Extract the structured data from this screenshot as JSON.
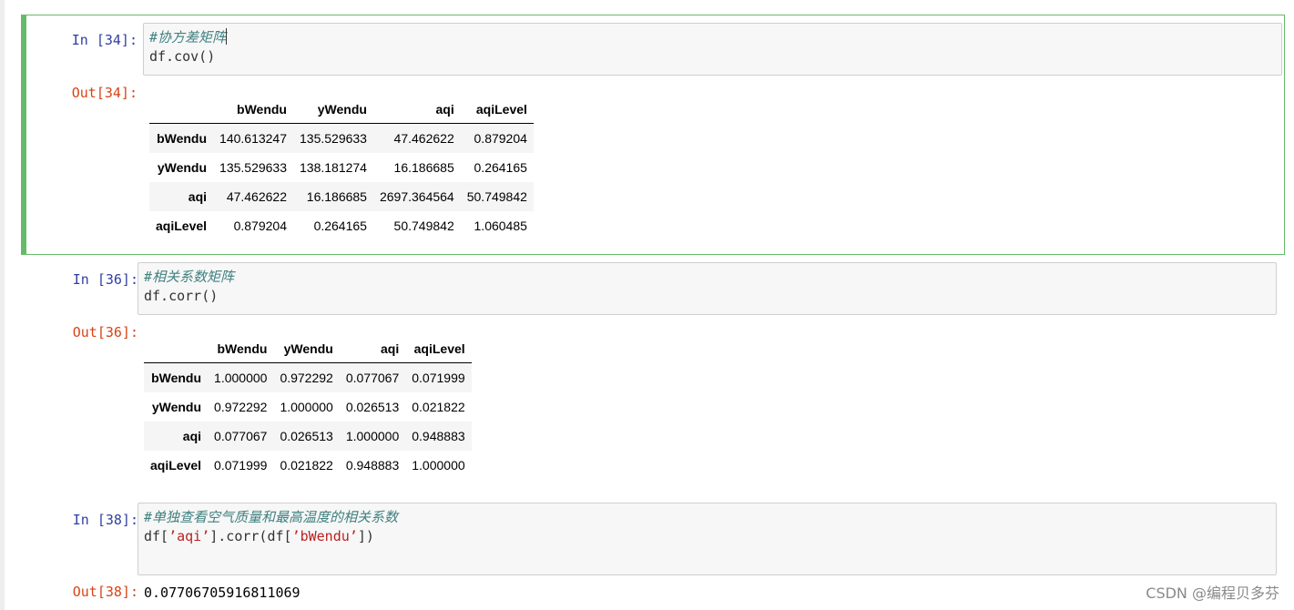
{
  "cells": [
    {
      "in_prompt": "In  [34]:",
      "code_comment": "#协方差矩阵",
      "code_line": "df.cov()",
      "out_prompt": "Out[34]:",
      "table": {
        "columns": [
          "",
          "bWendu",
          "yWendu",
          "aqi",
          "aqiLevel"
        ],
        "rows": [
          [
            "bWendu",
            "140.613247",
            "135.529633",
            "47.462622",
            "0.879204"
          ],
          [
            "yWendu",
            "135.529633",
            "138.181274",
            "16.186685",
            "0.264165"
          ],
          [
            "aqi",
            "47.462622",
            "16.186685",
            "2697.364564",
            "50.749842"
          ],
          [
            "aqiLevel",
            "0.879204",
            "0.264165",
            "50.749842",
            "1.060485"
          ]
        ]
      }
    },
    {
      "in_prompt": "In  [36]:",
      "code_comment": "#相关系数矩阵",
      "code_line": "df.corr()",
      "out_prompt": "Out[36]:",
      "table": {
        "columns": [
          "",
          "bWendu",
          "yWendu",
          "aqi",
          "aqiLevel"
        ],
        "rows": [
          [
            "bWendu",
            "1.000000",
            "0.972292",
            "0.077067",
            "0.071999"
          ],
          [
            "yWendu",
            "0.972292",
            "1.000000",
            "0.026513",
            "0.021822"
          ],
          [
            "aqi",
            "0.077067",
            "0.026513",
            "1.000000",
            "0.948883"
          ],
          [
            "aqiLevel",
            "0.071999",
            "0.021822",
            "0.948883",
            "1.000000"
          ]
        ]
      }
    },
    {
      "in_prompt": "In  [38]:",
      "code_comment": "#单独查看空气质量和最高温度的相关系数",
      "code_parts": [
        "df[",
        "’aqi’",
        "].corr(df[",
        "’bWendu’",
        "])"
      ],
      "out_prompt": "Out[38]:",
      "output_text": "0.07706705916811069"
    }
  ],
  "watermark": "CSDN @编程贝多芬",
  "colors": {
    "selected_border": "#66bb6a",
    "in_prompt": "#303f9f",
    "out_prompt": "#d84315",
    "comment": "#408080",
    "string": "#ba2121"
  }
}
